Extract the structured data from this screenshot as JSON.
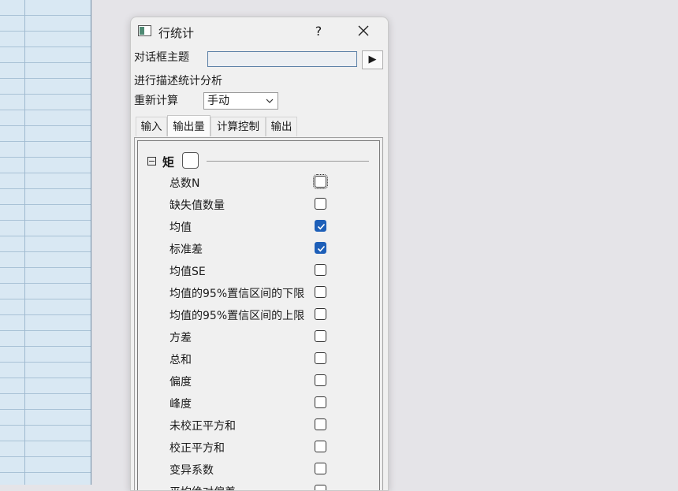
{
  "dialog": {
    "title": "行统计",
    "help_label": "?",
    "theme_label": "对话框主题",
    "theme_value": "",
    "play_label": "▶",
    "description": "进行描述统计分析",
    "recalc_label": "重新计算",
    "recalc_value": "手动"
  },
  "tabs": [
    {
      "label": "输入"
    },
    {
      "label": "输出量"
    },
    {
      "label": "计算控制"
    },
    {
      "label": "输出"
    }
  ],
  "group": {
    "title": "矩",
    "checked": false
  },
  "items": [
    {
      "label": "总数N",
      "checked": false,
      "focused": true
    },
    {
      "label": "缺失值数量",
      "checked": false
    },
    {
      "label": "均值",
      "checked": true
    },
    {
      "label": "标准差",
      "checked": true
    },
    {
      "label": "均值SE",
      "checked": false
    },
    {
      "label": "均值的95%置信区间的下限",
      "checked": false
    },
    {
      "label": "均值的95%置信区间的上限",
      "checked": false
    },
    {
      "label": "方差",
      "checked": false
    },
    {
      "label": "总和",
      "checked": false
    },
    {
      "label": "偏度",
      "checked": false
    },
    {
      "label": "峰度",
      "checked": false
    },
    {
      "label": "未校正平方和",
      "checked": false
    },
    {
      "label": "校正平方和",
      "checked": false
    },
    {
      "label": "变异系数",
      "checked": false
    },
    {
      "label": "平均绝对偏差",
      "checked": false
    }
  ]
}
